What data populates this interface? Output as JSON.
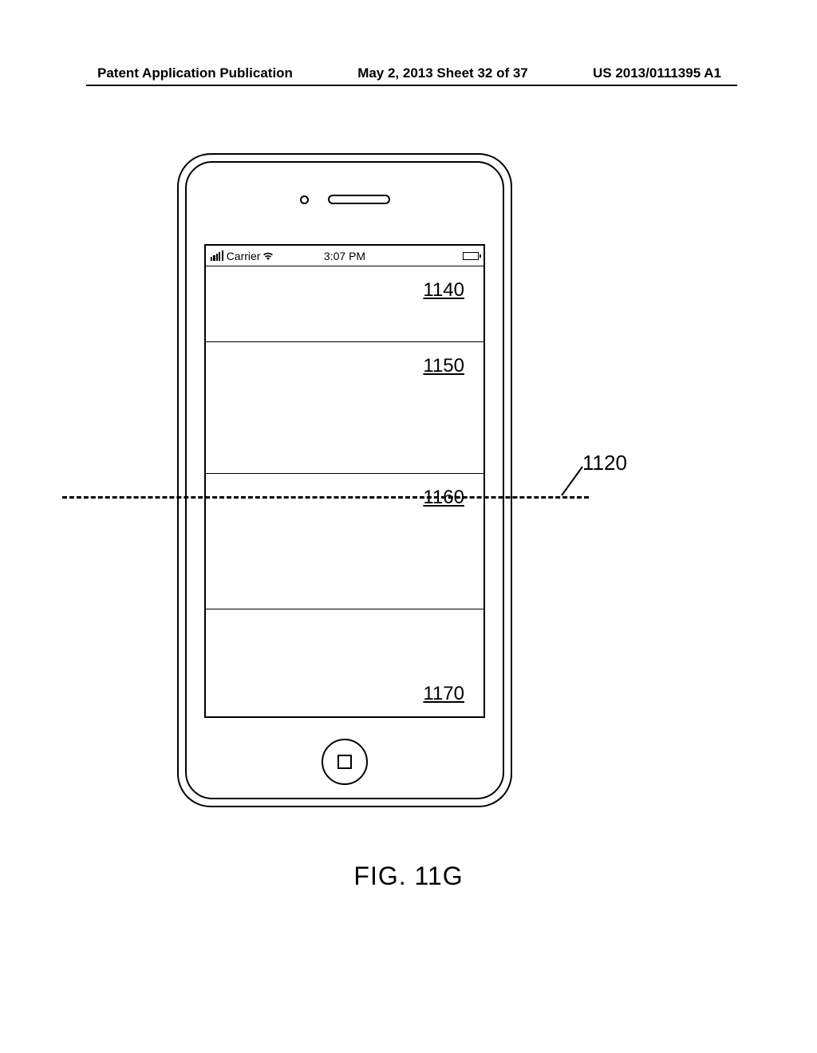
{
  "header": {
    "left": "Patent Application Publication",
    "center": "May 2, 2013  Sheet 32 of 37",
    "right": "US 2013/0111395 A1"
  },
  "statusbar": {
    "carrier": "Carrier",
    "time": "3:07 PM"
  },
  "refs": {
    "r1": "1140",
    "r2": "1150",
    "r3": "1160",
    "r4": "1170",
    "midline": "1120"
  },
  "figure_label": "FIG. 11G"
}
